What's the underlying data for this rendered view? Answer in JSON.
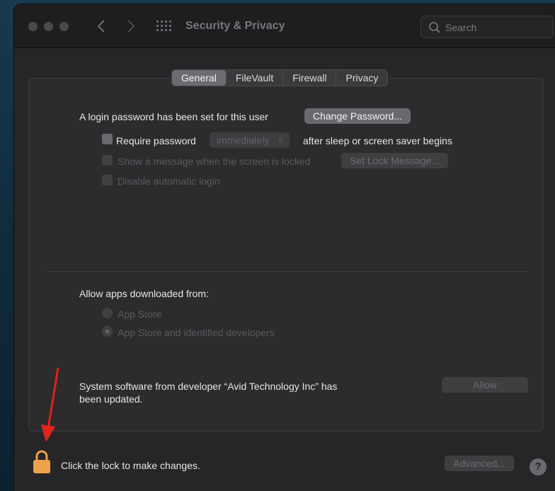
{
  "window": {
    "title": "Security & Privacy",
    "search_placeholder": "Search"
  },
  "tabs": [
    {
      "label": "General",
      "active": true
    },
    {
      "label": "FileVault",
      "active": false
    },
    {
      "label": "Firewall",
      "active": false
    },
    {
      "label": "Privacy",
      "active": false
    }
  ],
  "general": {
    "login_password_text": "A login password has been set for this user",
    "change_password_label": "Change Password...",
    "require_password_label": "Require password",
    "require_password_value": "immediately",
    "after_sleep_text": "after sleep or screen saver begins",
    "show_message_label": "Show a message when the screen is locked",
    "set_lock_message_label": "Set Lock Message...",
    "disable_auto_login_label": "Disable automatic login"
  },
  "allow_apps": {
    "heading": "Allow apps downloaded from:",
    "option_app_store": "App Store",
    "option_identified": "App Store and identified developers"
  },
  "system_software": {
    "line1": "System software from developer “Avid Technology Inc” has",
    "line2": "been updated.",
    "allow_label": "Allow"
  },
  "footer": {
    "lock_text": "Click the lock to make changes.",
    "advanced_label": "Advanced...",
    "help_label": "?"
  },
  "colors": {
    "lock": "#f0a04b",
    "annotation_arrow": "#e0231c"
  },
  "icons": {
    "lock": "lock-icon",
    "back": "chevron-left-icon",
    "forward": "chevron-right-icon",
    "grid": "grid-icon",
    "search": "search-icon",
    "popup": "up-down-chevron-icon"
  }
}
